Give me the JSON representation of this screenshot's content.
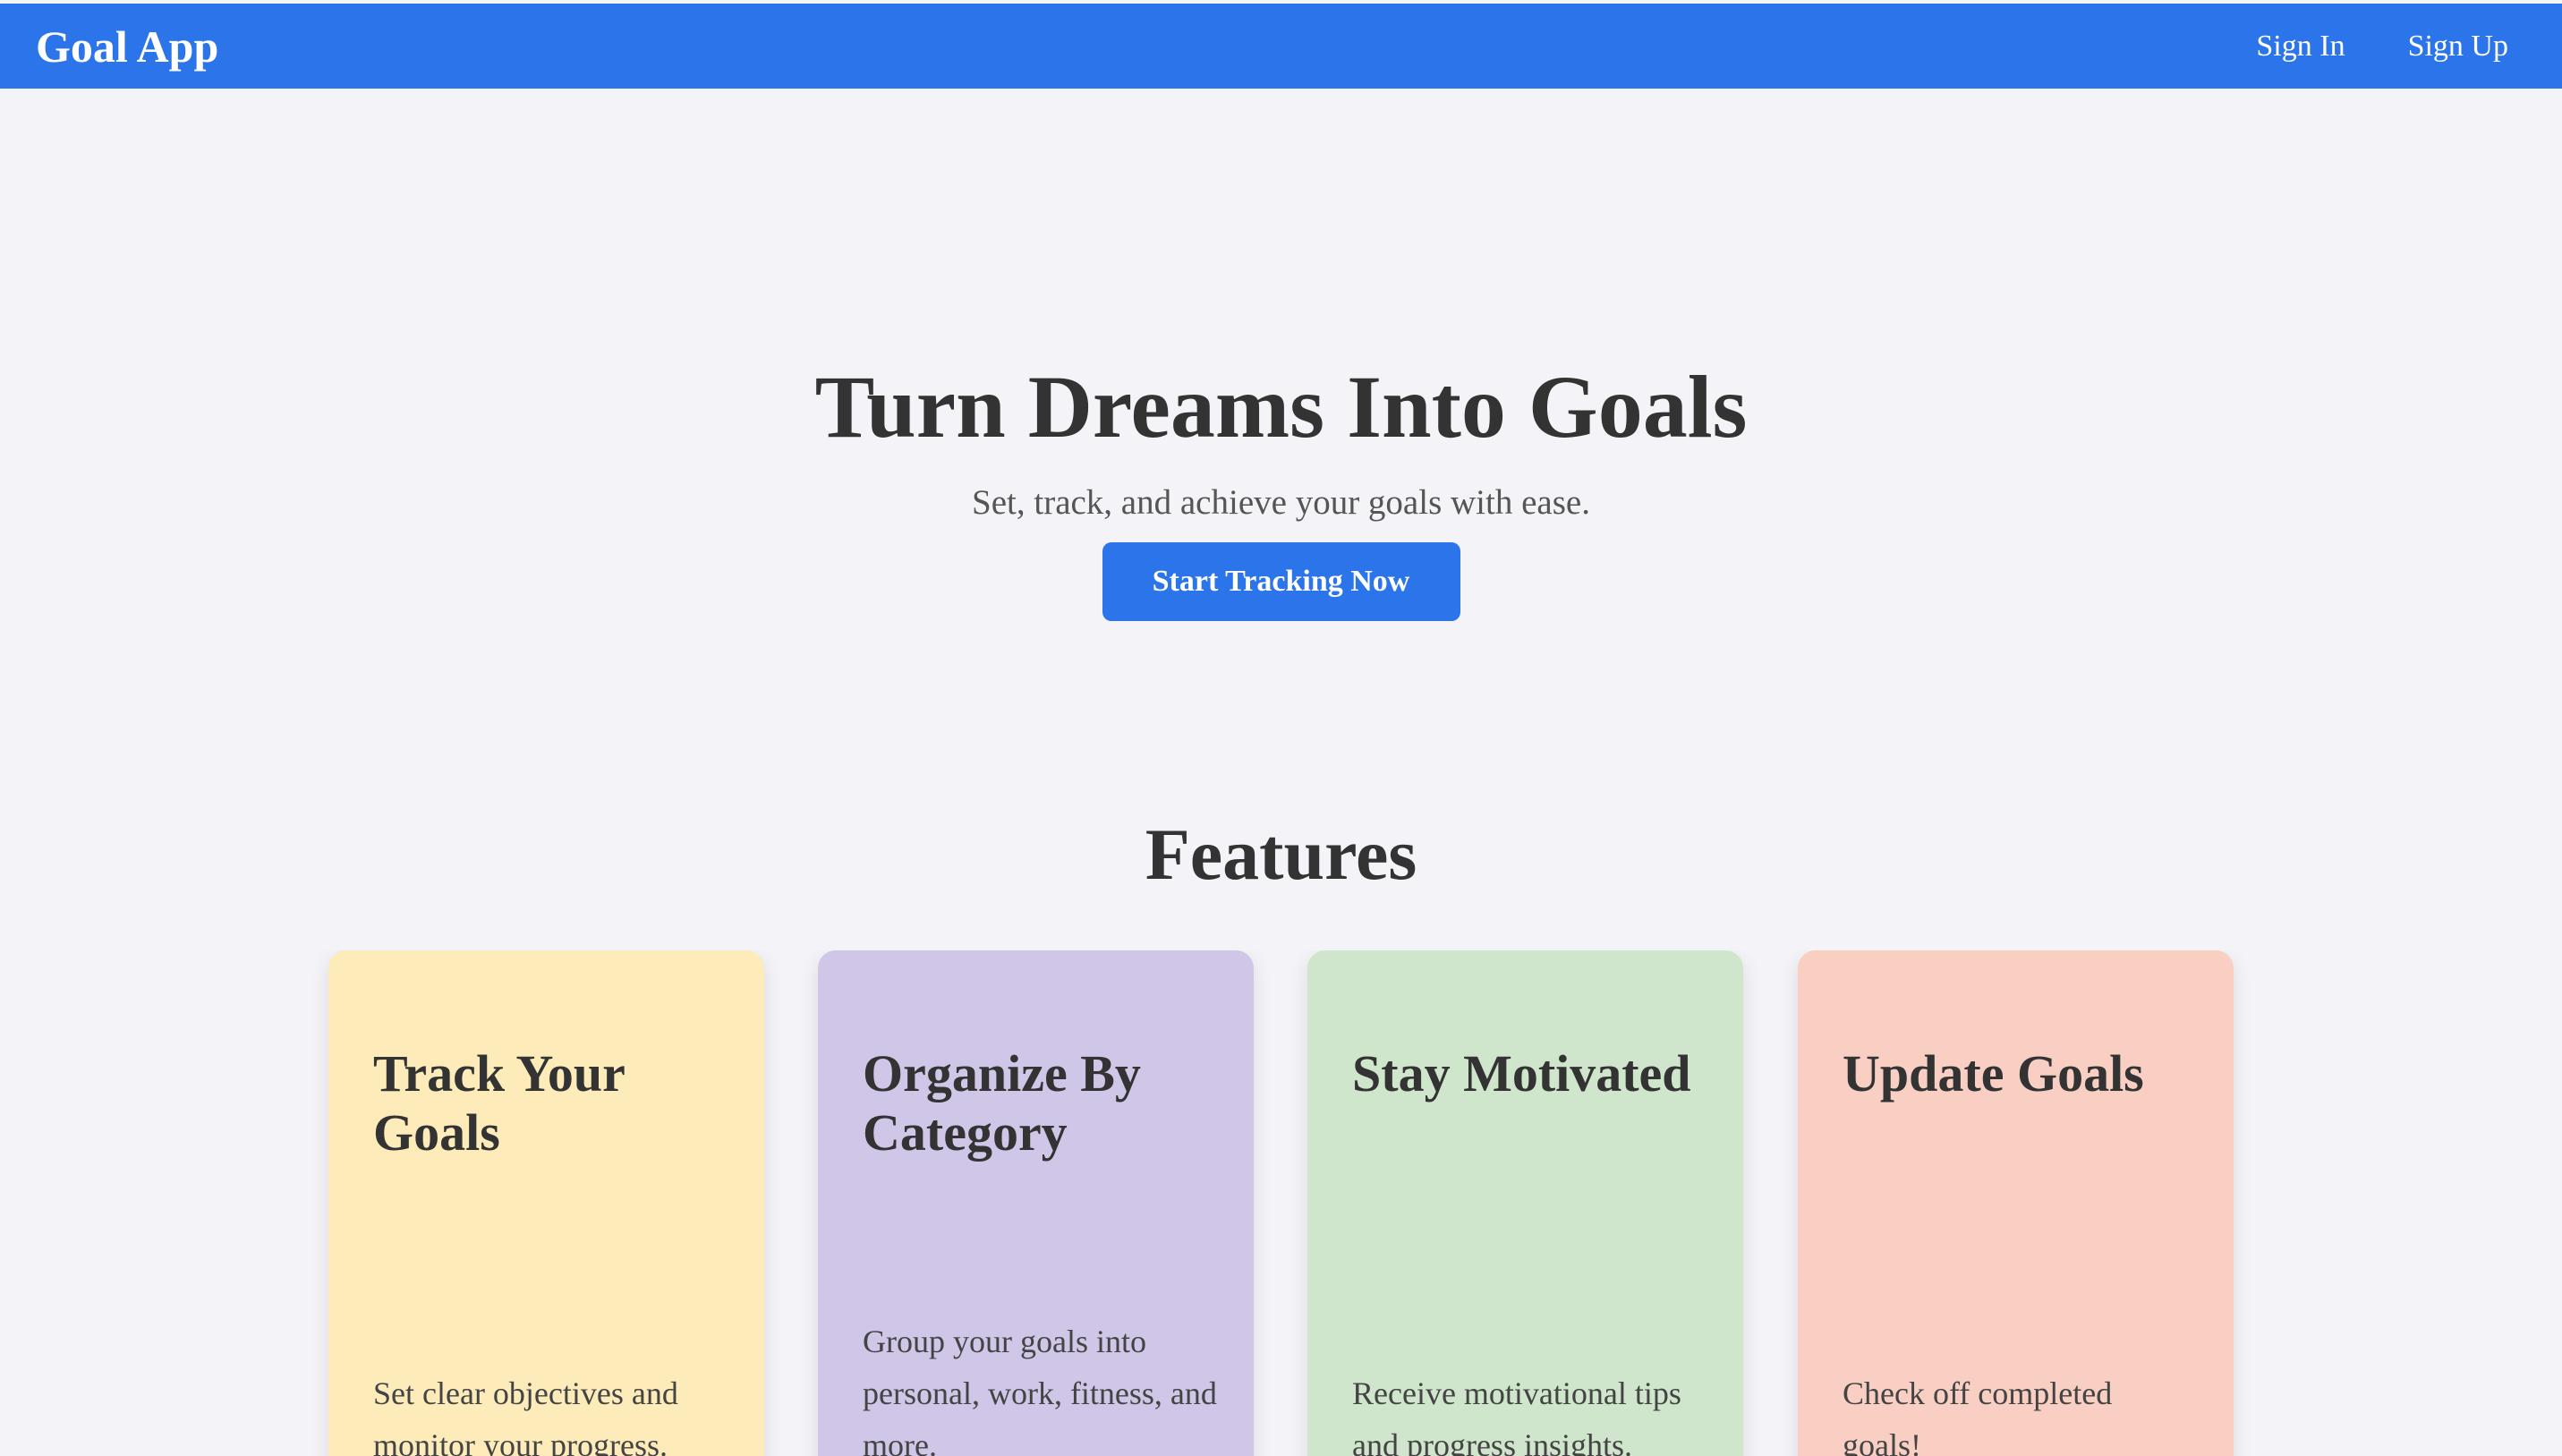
{
  "nav": {
    "brand": "Goal App",
    "sign_in": "Sign In",
    "sign_up": "Sign Up"
  },
  "hero": {
    "title": "Turn Dreams Into Goals",
    "subtitle": "Set, track, and achieve your goals with ease.",
    "cta": "Start Tracking Now"
  },
  "features": {
    "title": "Features",
    "cards": [
      {
        "title": "Track Your Goals",
        "description": "Set clear objectives and monitor your progress.",
        "color": "#fdecba"
      },
      {
        "title": "Organize By Category",
        "description": "Group your goals into personal, work, fitness, and more.",
        "color": "#d0c6e7"
      },
      {
        "title": "Stay Motivated",
        "description": "Receive motivational tips and progress insights.",
        "color": "#cfe5cc"
      },
      {
        "title": "Update Goals",
        "description": "Check off completed goals!",
        "color": "#f8cfc2"
      }
    ]
  },
  "colors": {
    "primary": "#2b74ea",
    "background": "#f4f4f8",
    "text": "#333333"
  }
}
